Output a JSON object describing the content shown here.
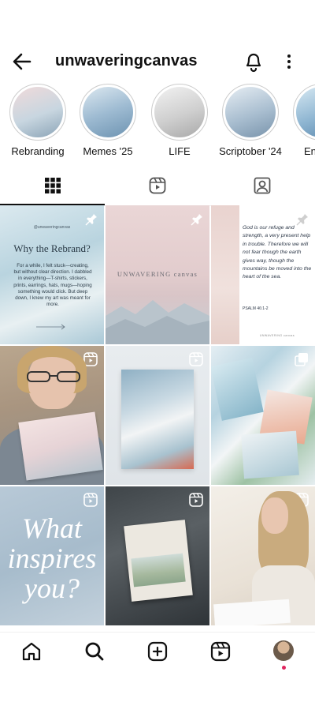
{
  "header": {
    "username": "unwaveringcanvas"
  },
  "highlights": [
    {
      "label": "Rebranding",
      "colors": [
        "#e8d5d6",
        "#9fb5c2"
      ]
    },
    {
      "label": "Memes '25",
      "colors": [
        "#c9d9e6",
        "#7aa0bd"
      ]
    },
    {
      "label": "LIFE",
      "colors": [
        "#e4e4e4",
        "#b3b3b3"
      ]
    },
    {
      "label": "Scriptober '24",
      "colors": [
        "#d3dde8",
        "#8fa8c0"
      ]
    },
    {
      "label": "En",
      "colors": [
        "#b8d4e5",
        "#6b96b8"
      ]
    }
  ],
  "tabs": [
    "grid",
    "reels",
    "tagged"
  ],
  "posts": [
    {
      "type": "carousel",
      "pinned": true,
      "title": "Why the Rebrand?",
      "handle": "@unwaveringcanvas",
      "body": "For a while, I felt stuck—creating, but without clear direction. I dabbled in everything—T-shirts, stickers, prints, earrings, hats, mugs—hoping something would click. But deep down, I knew my art was meant for more."
    },
    {
      "type": "image",
      "pinned": true,
      "text": "UNWAVERING canvas"
    },
    {
      "type": "image",
      "pinned": true,
      "verse": "God is our refuge and strength, a very present help in trouble. Therefore we will not fear though the earth gives way, though the mountains be moved into the heart of the sea.",
      "ref": "PSALM 46:1-2",
      "brand": "UNWAVERING canvas"
    },
    {
      "type": "reel"
    },
    {
      "type": "reel"
    },
    {
      "type": "carousel"
    },
    {
      "type": "reel",
      "text": "What inspires you?"
    },
    {
      "type": "reel"
    },
    {
      "type": "reel"
    }
  ],
  "colors": {
    "accent": "#e0245e"
  }
}
